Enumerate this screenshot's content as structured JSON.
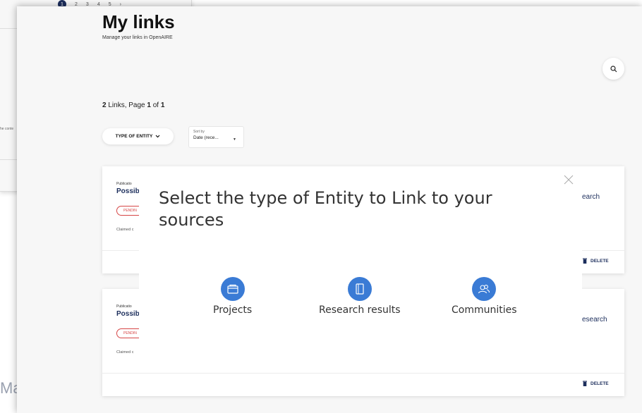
{
  "background_window": {
    "pagination": [
      "1",
      "2",
      "3",
      "4",
      "5",
      "›"
    ],
    "side_text": "he conte",
    "bottom_text": "Ma"
  },
  "page": {
    "title": "My links",
    "subtitle": "Manage your links in OpenAIRE",
    "results": {
      "count": "2",
      "count_label": "Links, Page",
      "page": "1",
      "of_label": "of",
      "total": "1"
    }
  },
  "filters": {
    "type_of_entity_label": "TYPE OF ENTITY",
    "sort_label": "Sort by",
    "sort_value": "Date (rece..."
  },
  "cards": [
    {
      "type": "Publicatio",
      "title": "Possib",
      "status": "PENDIN",
      "claimed": "Claimed c",
      "right_text": "earch",
      "delete_label": "DELETE"
    },
    {
      "type": "Publicatio",
      "title": "Possib",
      "status": "PENDIN",
      "claimed": "Claimed c",
      "right_text": "esearch",
      "delete_label": "DELETE"
    }
  ],
  "modal": {
    "title": "Select the type of Entity to Link to your sources",
    "options": [
      {
        "label": "Projects",
        "icon": "folder-icon"
      },
      {
        "label": "Research results",
        "icon": "document-icon"
      },
      {
        "label": "Communities",
        "icon": "people-icon"
      }
    ]
  },
  "colors": {
    "accent": "#3a7bd5",
    "navy": "#1c2e5c",
    "pending_red": "#d64545",
    "background": "#f7f7f7"
  }
}
